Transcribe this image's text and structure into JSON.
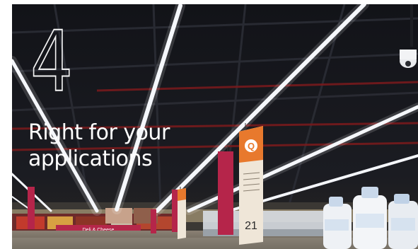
{
  "overlay": {
    "number": "4",
    "title_line1": "Right for your",
    "title_line2": "applications"
  },
  "scene": {
    "aisle_sign_number": "21",
    "aisle_sign_letter": "Q",
    "store_sign_text": "Deli & Cheese"
  },
  "colors": {
    "ceiling": "#0d0e11",
    "light_strip": "#f4f6fb",
    "banner_red": "#b5254a",
    "sign_orange": "#e8792d",
    "text": "#ffffff"
  }
}
